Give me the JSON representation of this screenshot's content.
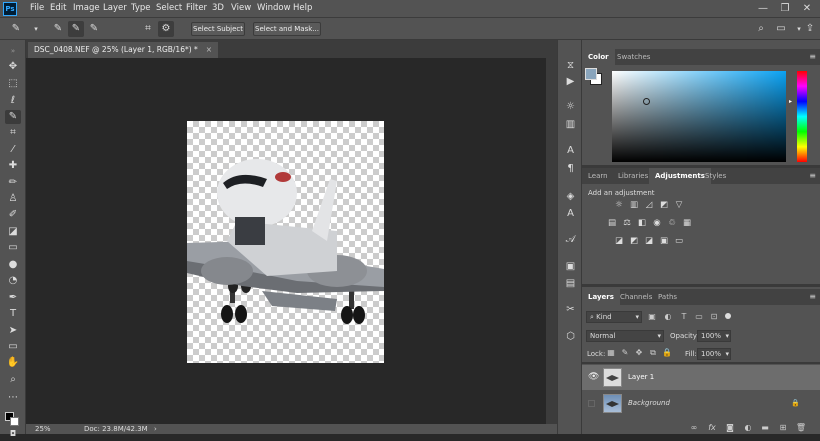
{
  "app": {
    "logo": "Ps"
  },
  "menu": [
    "File",
    "Edit",
    "Image",
    "Layer",
    "Type",
    "Select",
    "Filter",
    "3D",
    "View",
    "Window",
    "Help"
  ],
  "window_controls": [
    "—",
    "❐",
    "✕"
  ],
  "options_bar": {
    "brush_size": "3",
    "select_subject": "Select Subject",
    "select_and_mask": "Select and Mask..."
  },
  "document": {
    "tab_title": "DSC_0408.NEF @ 25% (Layer 1, RGB/16*) *",
    "close": "×"
  },
  "status": {
    "zoom": "25%",
    "doc": "Doc: 23.8M/42.3M",
    "arrow": "›"
  },
  "colors": {
    "accent": "#31a8ff",
    "fg_swatch": "#8aa5bc",
    "bg_swatch": "#ffffff"
  },
  "panels": {
    "color_tabs": [
      "Color",
      "Swatches"
    ],
    "adjust_tabs": [
      "Learn",
      "Libraries",
      "Adjustments",
      "Styles"
    ],
    "adjust_heading": "Add an adjustment",
    "layers_tabs": [
      "Layers",
      "Channels",
      "Paths"
    ],
    "filter_kind": "Kind",
    "blend_mode": "Normal",
    "opacity_label": "Opacity:",
    "opacity_value": "100%",
    "lock_label": "Lock:",
    "fill_label": "Fill:",
    "fill_value": "100%",
    "layers": [
      {
        "name": "Layer 1",
        "visible": true,
        "selected": true
      },
      {
        "name": "Background",
        "visible": false,
        "locked": true
      }
    ],
    "footer_icons": [
      "link-icon",
      "fx-icon",
      "mask-icon",
      "adjustment-icon",
      "folder-icon",
      "new-layer-icon",
      "trash-icon"
    ],
    "footer_fx": "fx"
  }
}
